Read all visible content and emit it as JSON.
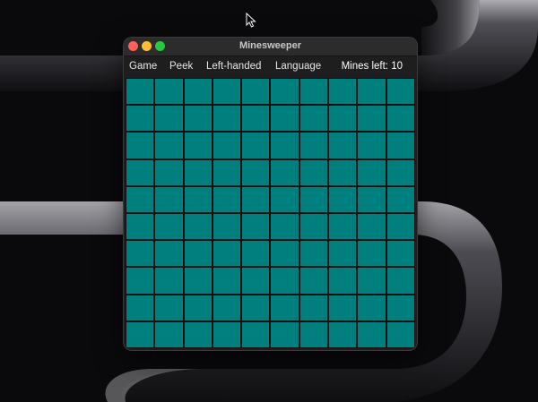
{
  "window": {
    "title": "Minesweeper"
  },
  "menu": {
    "items": [
      "Game",
      "Peek",
      "Left-handed",
      "Language"
    ]
  },
  "status": {
    "mines_left": "Mines left: 10"
  },
  "board": {
    "rows": 10,
    "cols": 10,
    "cell_color": "#007f7f",
    "state": "covered"
  },
  "colors": {
    "close": "#fe5f57",
    "minimize": "#febc2e",
    "maximize": "#28c840"
  }
}
